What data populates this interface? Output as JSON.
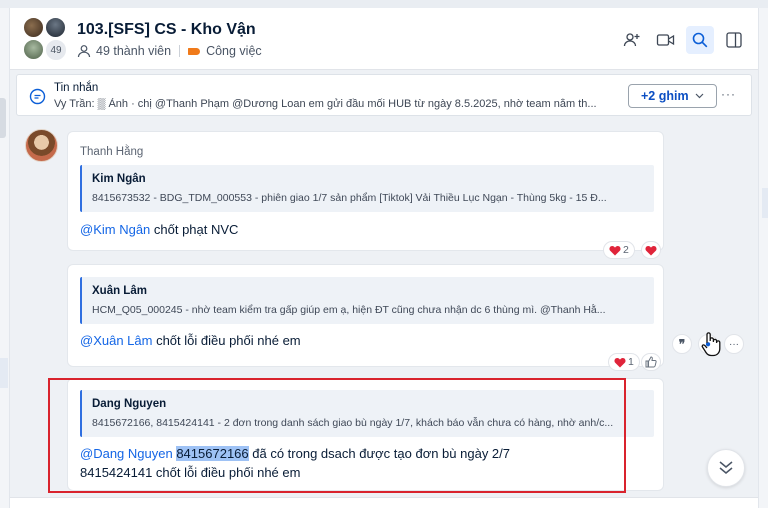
{
  "header": {
    "title": "103.[SFS] CS - Kho Vận",
    "member_count_badge": "49",
    "members": "49 thành viên",
    "tag": "Công việc"
  },
  "pinned": {
    "title": "Tin nhắn",
    "preview": "Vy Trần: ▒ Ảnh · chị @Thanh Phạm @Dương Loan em gửi đầu mối HUB từ ngày 8.5.2025, nhờ team nắm th...",
    "more_button": "+2 ghim"
  },
  "messages": [
    {
      "sender": "Thanh Hằng",
      "quote_name": "Kim Ngân",
      "quote_text": "8415673532 - BDG_TDM_000553 - phiên giao 1/7 sản phẩm [Tiktok] Vải Thiều Lục Ngạn - Thùng 5kg - 15 Đ...",
      "mention": "@Kim Ngân",
      "text": " chốt phạt NVC",
      "reaction_count": "2"
    },
    {
      "quote_name": "Xuân Lâm",
      "quote_text": "HCM_Q05_000245 - nhờ team kiểm tra gấp giúp em ạ, hiện ĐT cũng chưa nhận dc 6 thùng mì. @Thanh Hằ...",
      "mention": "@Xuân Lâm",
      "text": " chốt lỗi điều phối nhé em",
      "reaction_count": "1"
    },
    {
      "quote_name": "Dang Nguyen",
      "quote_text": "8415672166, 8415424141 - 2 đơn trong danh sách giao bù ngày 1/7, khách báo vẫn chưa có hàng, nhờ anh/c...",
      "mention": "@Dang Nguyen",
      "highlight": "8415672166",
      "text_line1": " đã có trong dsach được tạo đơn bù ngày 2/7",
      "text_line2": "8415424141 chốt lỗi điều phối nhé em"
    }
  ],
  "colors": {
    "accent": "#1466e6",
    "highlight_box": "#d9232d",
    "reaction_heart": "#e0243a",
    "tag": "#f07a1a"
  }
}
